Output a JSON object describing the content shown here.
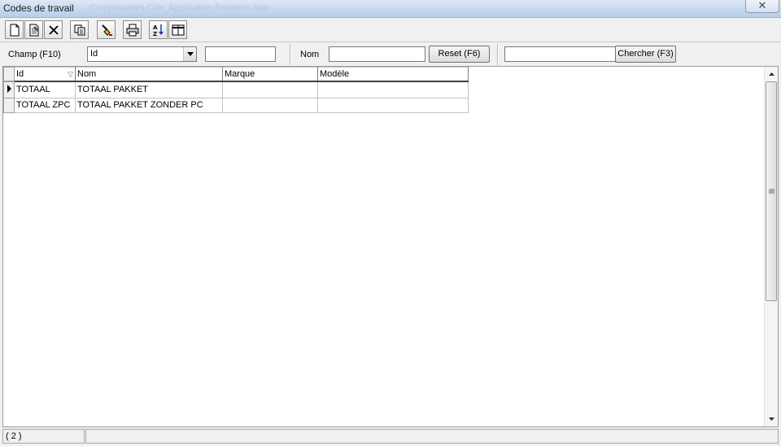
{
  "window": {
    "title": "Codes de travail",
    "background_ghost_text": "Composantes   Cde_Application   Fenêtres   Aide",
    "close_label": "✕"
  },
  "toolbar": {
    "buttons": [
      {
        "icon": "new-document-icon"
      },
      {
        "icon": "edit-record-icon"
      },
      {
        "icon": "delete-icon"
      },
      {
        "icon": "copy-icon"
      },
      {
        "icon": "filter-brush-icon"
      },
      {
        "icon": "print-icon"
      },
      {
        "icon": "sort-az-icon"
      },
      {
        "icon": "columns-icon"
      }
    ]
  },
  "filter_bar": {
    "field_label": "Champ (F10)",
    "field_value": "Id",
    "field_text_value": "",
    "name_label": "Nom",
    "name_value": "",
    "reset_label": "Reset (F6)",
    "search_value": "",
    "search_label": "Chercher (F3)"
  },
  "grid": {
    "columns": [
      "Id",
      "Nom",
      "Marque",
      "Modèle"
    ],
    "rows": [
      {
        "id": "TOTAAL",
        "nom": "TOTAAL PAKKET",
        "marque": "",
        "modele": "",
        "current": true
      },
      {
        "id": "TOTAAL ZPC",
        "nom": "TOTAAL PAKKET ZONDER PC",
        "marque": "",
        "modele": "",
        "current": false
      }
    ]
  },
  "status": {
    "record_count": "( 2 )",
    "message": ""
  },
  "colors": {
    "title_gradient": "#c9daef",
    "window_bg": "#f0f0f0"
  }
}
